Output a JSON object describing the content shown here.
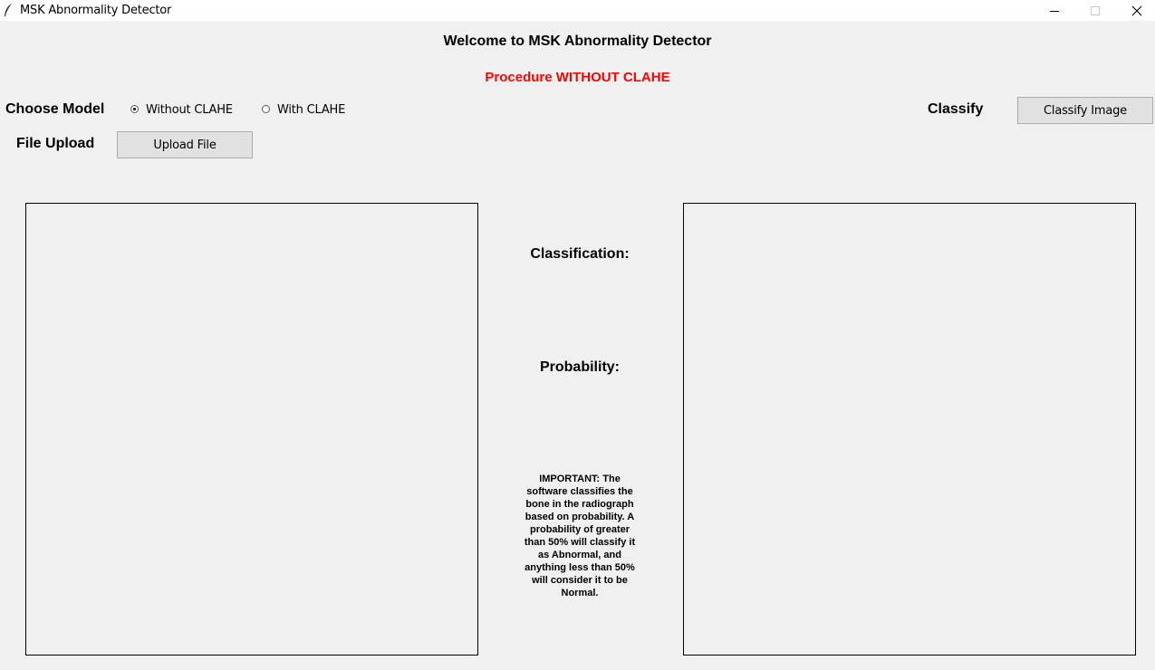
{
  "window": {
    "title": "MSK Abnormality Detector",
    "controls": {
      "minimize": "minimize-icon",
      "maximize": "maximize-icon",
      "close": "close-icon"
    }
  },
  "header": {
    "welcome": "Welcome to MSK Abnormality Detector",
    "procedure": "Procedure WITHOUT CLAHE",
    "procedure_color": "#ff0000"
  },
  "model": {
    "label": "Choose Model",
    "options": [
      {
        "label": "Without CLAHE",
        "selected": true
      },
      {
        "label": "With CLAHE",
        "selected": false
      }
    ]
  },
  "upload": {
    "label": "File Upload",
    "button": "Upload File"
  },
  "classify": {
    "label": "Classify",
    "button": "Classify Image"
  },
  "results": {
    "classification_label": "Classification:",
    "probability_label": "Probability:",
    "note": "IMPORTANT: The software classifies the bone in the radiograph based on probability. A probability of greater than 50% will classify it as Abnormal, and anything less than 50% will consider it to be Normal."
  }
}
